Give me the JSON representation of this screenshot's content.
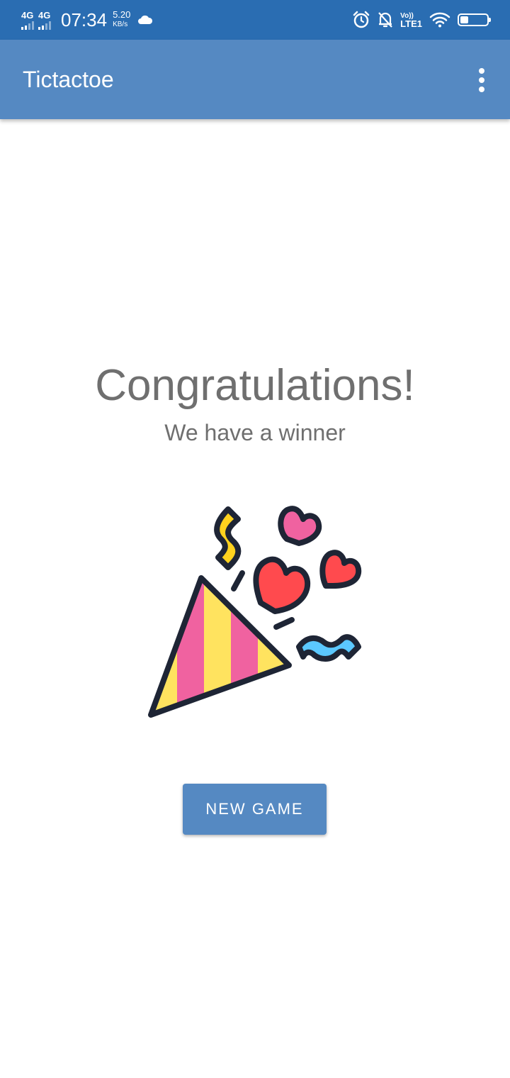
{
  "status_bar": {
    "network1": "4G",
    "network2": "4G",
    "time": "07:34",
    "speed_value": "5.20",
    "speed_unit": "KB/s",
    "volte_top": "Vo))",
    "volte_bottom": "LTE1",
    "icons": [
      "cloud-icon",
      "alarm-icon",
      "notifications-off-icon",
      "wifi-icon",
      "battery-icon"
    ],
    "battery_level_percent": 30
  },
  "app_bar": {
    "title": "Tictactoe",
    "menu_icon": "more-vert-icon"
  },
  "main": {
    "headline": "Congratulations!",
    "subheadline": "We have a winner",
    "illustration": "party-popper-icon",
    "new_game_label": "NEW GAME"
  },
  "colors": {
    "status_bar": "#2a6db2",
    "app_bar": "#5589c2",
    "button": "#5589c2",
    "text_gray": "#6f6f6f"
  }
}
